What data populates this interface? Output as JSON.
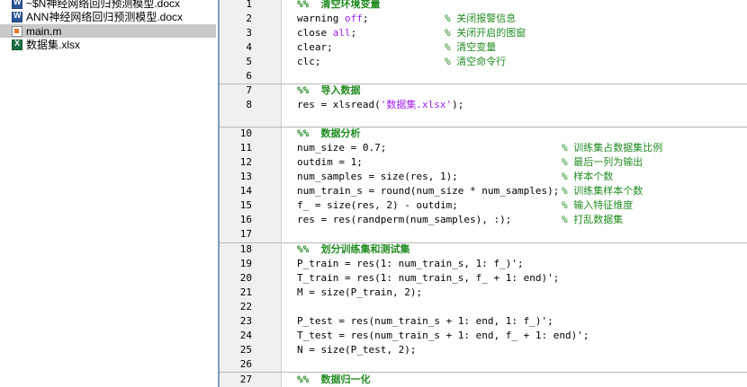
{
  "files": [
    {
      "name": "~$N神经网络回归预测模型.docx",
      "icon": "word-icon",
      "selected": false
    },
    {
      "name": "ANN神经网络回归预测模型.docx",
      "icon": "word-icon",
      "selected": false
    },
    {
      "name": "main.m",
      "icon": "matlab-file-icon",
      "selected": true
    },
    {
      "name": "数据集.xlsx",
      "icon": "excel-icon",
      "selected": false
    }
  ],
  "colors": {
    "comment": "#228b22",
    "keyword": "#a020f0",
    "selected_row": "#c9c9c9"
  },
  "code": [
    {
      "n": "1",
      "code": "%%  清空环境变量",
      "comment": "",
      "section": true
    },
    {
      "n": "2",
      "code": "warning off;",
      "comment": "% 关闭报警信息"
    },
    {
      "n": "3",
      "code": "close all;",
      "comment": "% 关闭开启的图窗"
    },
    {
      "n": "4",
      "code": "clear;",
      "comment": "% 清空变量"
    },
    {
      "n": "5",
      "code": "clc;",
      "comment": "% 清空命令行"
    },
    {
      "n": "6",
      "code": "",
      "comment": ""
    },
    {
      "n": "7",
      "code": "%%  导入数据",
      "comment": "",
      "section": true
    },
    {
      "n": "8",
      "code": "res = xlsread('数据集.xlsx');",
      "comment": ""
    },
    {
      "n": "10",
      "code": "%%  数据分析",
      "comment": "",
      "section": true
    },
    {
      "n": "11",
      "code": "num_size = 0.7;",
      "comment": "% 训练集占数据集比例"
    },
    {
      "n": "12",
      "code": "outdim = 1;",
      "comment": "% 最后一列为输出"
    },
    {
      "n": "13",
      "code": "num_samples = size(res, 1);",
      "comment": "% 样本个数"
    },
    {
      "n": "14",
      "code": "num_train_s = round(num_size * num_samples);",
      "comment": "% 训练集样本个数"
    },
    {
      "n": "15",
      "code": "f_ = size(res, 2) - outdim;",
      "comment": "% 输入特征维度"
    },
    {
      "n": "16",
      "code": "res = res(randperm(num_samples), :);",
      "comment": "% 打乱数据集"
    },
    {
      "n": "17",
      "code": "",
      "comment": ""
    },
    {
      "n": "18",
      "code": "%%  划分训练集和测试集",
      "comment": "",
      "section": true
    },
    {
      "n": "19",
      "code": "P_train = res(1: num_train_s, 1: f_)';",
      "comment": ""
    },
    {
      "n": "20",
      "code": "T_train = res(1: num_train_s, f_ + 1: end)';",
      "comment": ""
    },
    {
      "n": "21",
      "code": "M = size(P_train, 2);",
      "comment": ""
    },
    {
      "n": "22",
      "code": "",
      "comment": ""
    },
    {
      "n": "23",
      "code": "P_test = res(num_train_s + 1: end, 1: f_)';",
      "comment": ""
    },
    {
      "n": "24",
      "code": "T_test = res(num_train_s + 1: end, f_ + 1: end)';",
      "comment": ""
    },
    {
      "n": "25",
      "code": "N = size(P_test, 2);",
      "comment": ""
    },
    {
      "n": "26",
      "code": "",
      "comment": ""
    },
    {
      "n": "27",
      "code": "%%  数据归一化",
      "comment": "",
      "section": true
    }
  ]
}
